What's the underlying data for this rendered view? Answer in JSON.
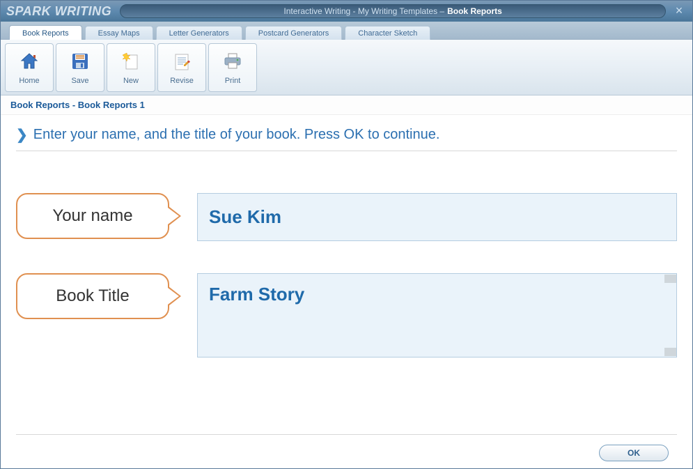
{
  "app_title": "SPARK WRITING",
  "title_prefix": "Interactive Writing - My Writing Templates – ",
  "title_strong": "Book Reports",
  "tabs": [
    {
      "label": "Book Reports",
      "active": true
    },
    {
      "label": "Essay Maps",
      "active": false
    },
    {
      "label": "Letter Generators",
      "active": false
    },
    {
      "label": "Postcard Generators",
      "active": false
    },
    {
      "label": "Character Sketch",
      "active": false
    }
  ],
  "toolbar": {
    "home": "Home",
    "save": "Save",
    "new": "New",
    "revise": "Revise",
    "print": "Print"
  },
  "breadcrumb": "Book Reports - Book Reports 1",
  "instruction": "Enter your name, and the title of your book. Press OK to continue.",
  "form": {
    "name_label": "Your name",
    "name_value": "Sue Kim",
    "title_label": "Book Title",
    "title_value": "Farm Story"
  },
  "ok_label": "OK"
}
